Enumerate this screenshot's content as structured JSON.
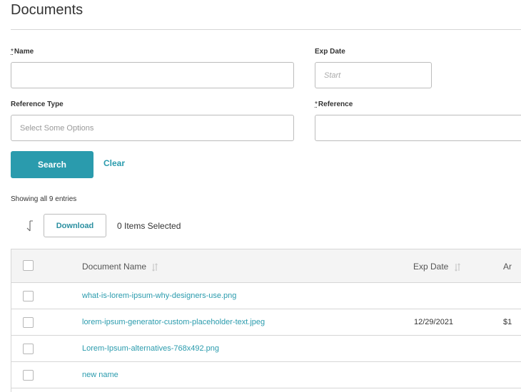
{
  "page": {
    "title": "Documents"
  },
  "form": {
    "required_mark": "*",
    "name_label": "Name",
    "name_value": "",
    "exp_date_label": "Exp Date",
    "exp_date_placeholder": "Start",
    "reference_type_label": "Reference Type",
    "reference_type_placeholder": "Select Some Options",
    "reference_label": "Reference",
    "reference_value": "",
    "search_label": "Search",
    "clear_label": "Clear"
  },
  "results": {
    "showing_text": "Showing all 9 entries",
    "download_label": "Download",
    "selected_text": "0 Items Selected"
  },
  "table": {
    "columns": {
      "document_name": "Document Name",
      "exp_date": "Exp Date",
      "amount_partial": "Ar"
    },
    "rows": [
      {
        "name": "what-is-lorem-ipsum-why-designers-use.png",
        "exp_date": "",
        "amount": ""
      },
      {
        "name": "lorem-ipsum-generator-custom-placeholder-text.jpeg",
        "exp_date": "12/29/2021",
        "amount": "$1"
      },
      {
        "name": "Lorem-Ipsum-alternatives-768x492.png",
        "exp_date": "",
        "amount": ""
      },
      {
        "name": "new name",
        "exp_date": "",
        "amount": ""
      }
    ]
  },
  "colors": {
    "accent": "#2a9bad",
    "border": "#bcbcbc",
    "header_bg": "#f4f4f4"
  },
  "icons": {
    "sort_toggle": "sort-toggle-icon",
    "column_sort": "sort-arrows-icon"
  }
}
